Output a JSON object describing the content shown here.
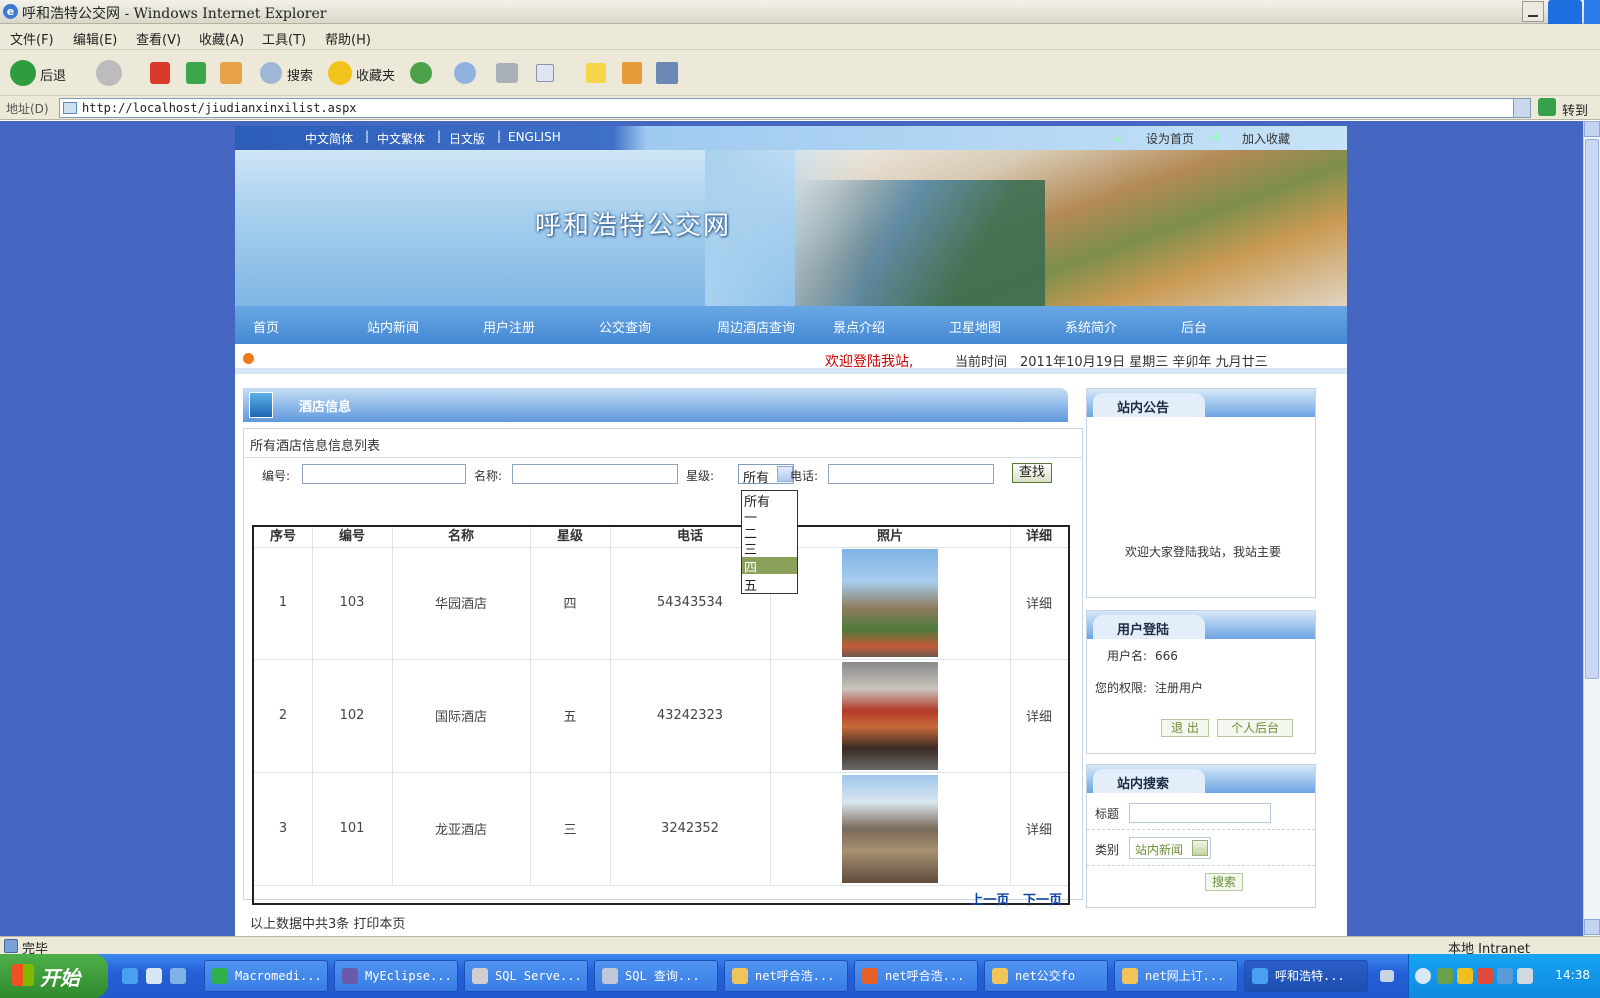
{
  "window": {
    "title": "呼和浩特公交网 - Windows Internet Explorer"
  },
  "menu": [
    "文件(F)",
    "编辑(E)",
    "查看(V)",
    "收藏(A)",
    "工具(T)",
    "帮助(H)"
  ],
  "toolbar": {
    "back": "后退",
    "search": "搜索",
    "favorites": "收藏夹"
  },
  "address": {
    "label": "地址(D)",
    "url": "http://localhost/jiudianxinxilist.aspx",
    "go": "转到"
  },
  "site": {
    "languages": [
      "中文简体",
      "中文繁体",
      "日文版",
      "ENGLISH"
    ],
    "set_home": "设为首页",
    "add_fav": "加入收藏",
    "name": "呼和浩特公交网",
    "nav": [
      "首页",
      "站内新闻",
      "用户注册",
      "公交查询",
      "周边酒店查询",
      "景点介绍",
      "卫星地图",
      "系统简介",
      "后台"
    ],
    "welcome": "欢迎登陆我站,",
    "time_label": "当前时间",
    "time_value": "2011年10月19日 星期三 辛卯年 九月廿三"
  },
  "hotel_panel": {
    "title": "酒店信息",
    "caption": "所有酒店信息信息列表",
    "search": {
      "id_label": "编号:",
      "name_label": "名称:",
      "star_label": "星级:",
      "star_value": "所有",
      "phone_label": "电话:",
      "find": "查找"
    },
    "star_options": [
      "所有",
      "一",
      "二",
      "三",
      "四",
      "五"
    ],
    "star_highlight": "四",
    "columns": [
      "序号",
      "编号",
      "名称",
      "星级",
      "电话",
      "照片",
      "详细"
    ],
    "rows": [
      {
        "no": "1",
        "id": "103",
        "name": "华园酒店",
        "star": "四",
        "phone": "54343534",
        "detail": "详细"
      },
      {
        "no": "2",
        "id": "102",
        "name": "国际酒店",
        "star": "五",
        "phone": "43242323",
        "detail": "详细"
      },
      {
        "no": "3",
        "id": "101",
        "name": "龙亚酒店",
        "star": "三",
        "phone": "3242352",
        "detail": "详细"
      }
    ],
    "prev": "上一页",
    "next": "下一页",
    "footer": "以上数据中共3条  打印本页"
  },
  "notice": {
    "title": "站内公告",
    "text": "欢迎大家登陆我站，我站主要"
  },
  "login": {
    "title": "用户登陆",
    "user_label": "用户名:",
    "user_value": "666",
    "role_label": "您的权限:",
    "role_value": "注册用户",
    "logout": "退 出",
    "personal": "个人后台"
  },
  "site_search": {
    "title": "站内搜索",
    "title_label": "标题",
    "type_label": "类别",
    "type_value": "站内新闻",
    "button": "搜索"
  },
  "status": {
    "text": "完毕",
    "zone": "本地 Intranet"
  },
  "taskbar": {
    "start": "开始",
    "tasks": [
      "Macromedi...",
      "MyEclipse...",
      "SQL Serve...",
      "SQL 查询...",
      "net呼合浩...",
      "net呼合浩...",
      "net公交fo",
      "net网上订...",
      "呼和浩特..."
    ],
    "clock": "14:38"
  },
  "colors": {
    "accent": "#4566c1",
    "nav": "#4589d3",
    "welcome": "#cc0000",
    "link": "#1144aa"
  }
}
